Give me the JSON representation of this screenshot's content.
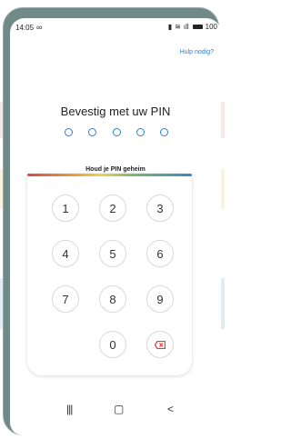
{
  "status_bar": {
    "time": "14:05",
    "link_icon": "infinity-icon",
    "indicators": [
      "vibrate-icon",
      "wifi-icon",
      "signal-icon"
    ],
    "battery": "100"
  },
  "header": {
    "help_link": "Hulp nodig?"
  },
  "pin": {
    "title": "Bevestig met uw PIN",
    "length": 5,
    "hint": "Houd je PIN geheim"
  },
  "keypad": {
    "keys": [
      "1",
      "2",
      "3",
      "4",
      "5",
      "6",
      "7",
      "8",
      "9",
      "0"
    ],
    "delete_icon": "backspace-icon"
  },
  "nav_bar": {
    "recent": "|||",
    "home": "▢",
    "back": "<"
  },
  "colors": {
    "accent": "#2d7fcf",
    "delete": "#e23d3d"
  }
}
